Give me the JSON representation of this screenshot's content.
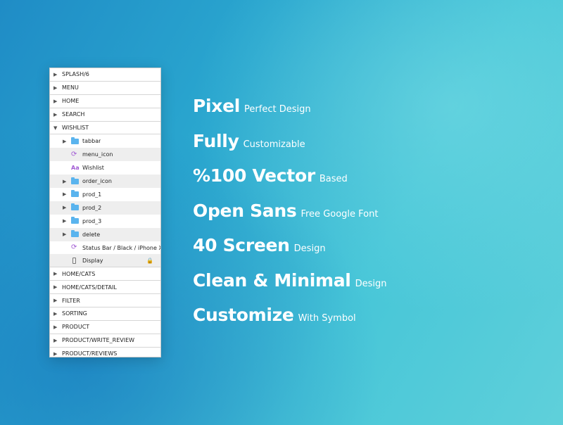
{
  "layers": [
    {
      "label": "SPLASH/6",
      "expanded": false
    },
    {
      "label": "MENU",
      "expanded": false
    },
    {
      "label": "HOME",
      "expanded": false
    },
    {
      "label": "SEARCH",
      "expanded": false
    },
    {
      "label": "WISHLIST",
      "expanded": true,
      "children": [
        {
          "label": "tabbar",
          "icon": "folder-icon",
          "arrow": true
        },
        {
          "label": "menu_icon",
          "icon": "symbol-icon",
          "arrow": false
        },
        {
          "label": "Wishlist",
          "icon": "text-icon",
          "icon_text": "Aa",
          "arrow": false
        },
        {
          "label": "order_icon",
          "icon": "folder-icon",
          "arrow": true
        },
        {
          "label": "prod_1",
          "icon": "folder-icon",
          "arrow": true
        },
        {
          "label": "prod_2",
          "icon": "folder-icon",
          "arrow": true
        },
        {
          "label": "prod_3",
          "icon": "folder-icon",
          "arrow": true
        },
        {
          "label": "delete",
          "icon": "folder-icon",
          "arrow": true
        },
        {
          "label": "Status Bar / Black / iPhone X",
          "icon": "symbol-icon",
          "arrow": false
        },
        {
          "label": "Display",
          "icon": "rectangle-icon",
          "arrow": false,
          "locked": true
        }
      ]
    },
    {
      "label": "HOME/CATS",
      "expanded": false
    },
    {
      "label": "HOME/CATS/DETAIL",
      "expanded": false
    },
    {
      "label": "FILTER",
      "expanded": false
    },
    {
      "label": "SORTING",
      "expanded": false
    },
    {
      "label": "PRODUCT",
      "expanded": false
    },
    {
      "label": "PRODUCT/WRITE_REVIEW",
      "expanded": false
    },
    {
      "label": "PRODUCT/REVIEWS",
      "expanded": false
    }
  ],
  "features": [
    {
      "bold": "Pixel",
      "light": "Perfect Design"
    },
    {
      "bold": "Fully",
      "light": "Customizable"
    },
    {
      "bold": "%100 Vector",
      "light": "Based"
    },
    {
      "bold": "Open Sans",
      "light": "Free Google Font"
    },
    {
      "bold": "40 Screen",
      "light": "Design"
    },
    {
      "bold": "Clean & Minimal",
      "light": "Design"
    },
    {
      "bold": "Customize",
      "light": "With Symbol"
    }
  ],
  "colors": {
    "folder": "#5ab4ee",
    "symbol": "#a25cd4"
  }
}
